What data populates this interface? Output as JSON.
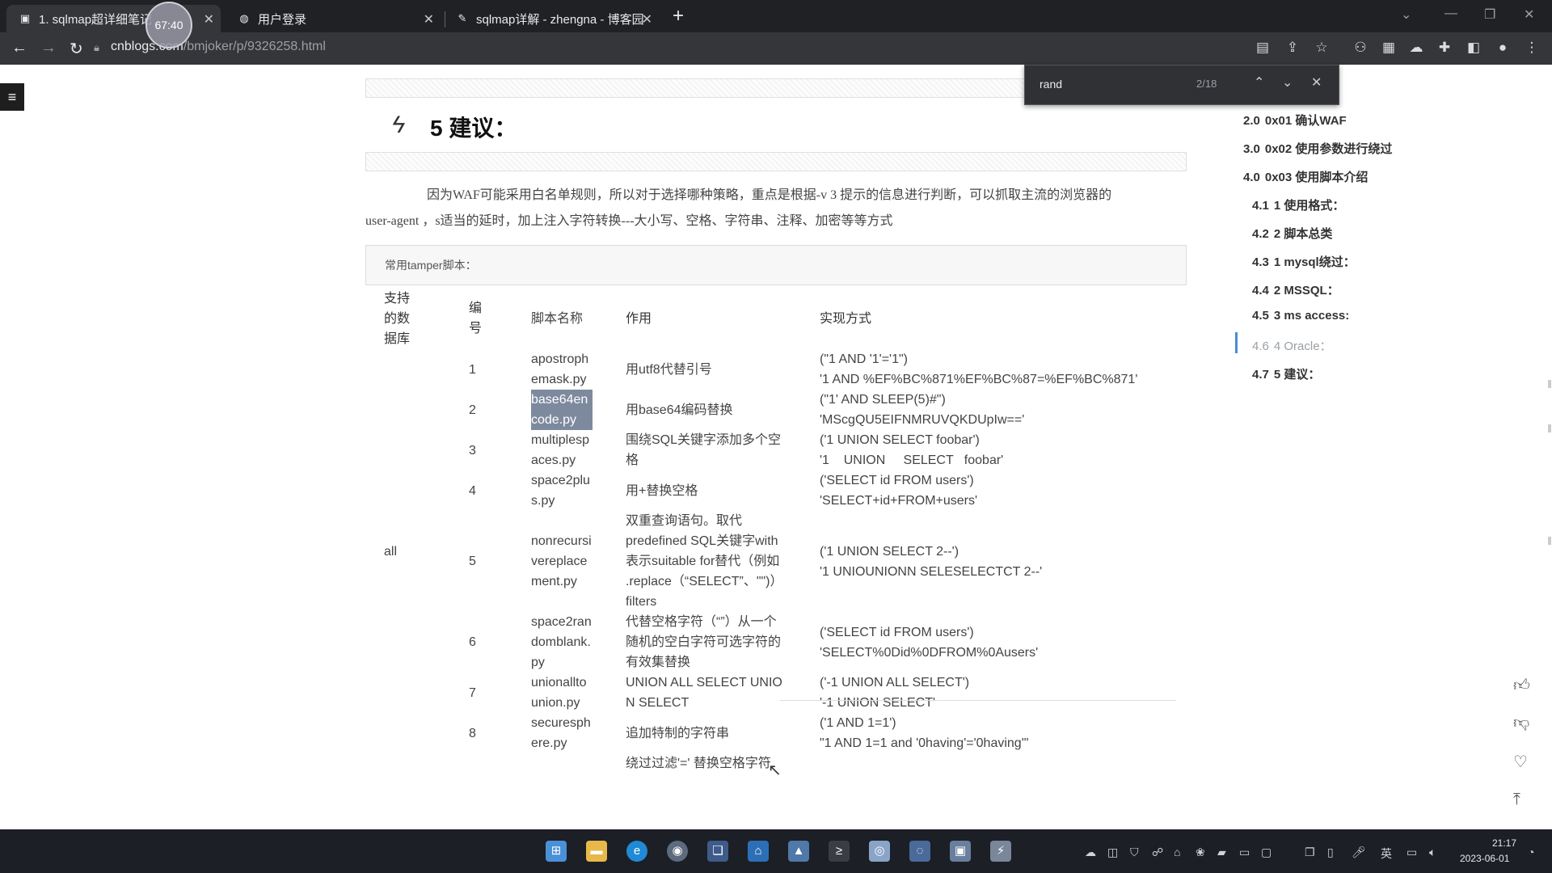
{
  "browser": {
    "tabs": [
      {
        "title": "1. sqlmap超详细笔记",
        "favicon": "blog-icon"
      },
      {
        "title": "用户登录",
        "favicon": "globe-icon"
      },
      {
        "title": "sqlmap详解 - zhengna - 博客园",
        "favicon": "feather-icon"
      }
    ],
    "timer": "67:40",
    "url_host": "cnblogs.com",
    "url_path": "/bmjoker/p/9326258.html"
  },
  "find": {
    "query": "rand",
    "count": "2/18"
  },
  "article": {
    "heading_number": "5",
    "heading_text": "建议：",
    "paragraph_line1": "因为WAF可能采用白名单规则，所以对于选择哪种策略，重点是根据-v 3 提示的信息进行判断，可以抓取主流的浏览器的",
    "paragraph_line2": "user-agent ，s适当的延时，加上注入字符转换---大小写、空格、字符串、注释、加密等等方式",
    "code_label": "常用tamper脚本：",
    "table": {
      "headers": [
        "支持的数据库",
        "编号",
        "脚本名称",
        "作用",
        "实现方式"
      ],
      "db": "all",
      "rows": [
        {
          "num": "1",
          "script": "apostrophemask.py",
          "effect": "用utf8代替引号",
          "impl1": "(\"1 AND '1'='1\")",
          "impl2": "'1 AND %EF%BC%871%EF%BC%87=%EF%BC%871'"
        },
        {
          "num": "2",
          "script": "base64encode.py",
          "effect": "用base64编码替换",
          "impl1": "(\"1' AND SLEEP(5)#\")",
          "impl2": "'MScgQU5EIFNMRUVQKDUpIw=='"
        },
        {
          "num": "3",
          "script": "multiplespaces.py",
          "effect": "围绕SQL关键字添加多个空格",
          "impl1": "('1 UNION SELECT foobar')",
          "impl2": "'1    UNION     SELECT   foobar'"
        },
        {
          "num": "4",
          "script": "space2plus.py",
          "effect": "用+替换空格",
          "impl1": "('SELECT id FROM users')",
          "impl2": "'SELECT+id+FROM+users'"
        },
        {
          "num": "5",
          "script": "nonrecursivereplacement.py",
          "effect": "双重查询语句。取代predefined SQL关键字with表示suitable for替代（例如 .replace（“SELECT”、\"\")） filters",
          "impl1": "('1 UNION SELECT 2--')",
          "impl2": "'1 UNIOUNIONN SELESELECTCT 2--'"
        },
        {
          "num": "6",
          "script": "space2randomblank.py",
          "effect": "代替空格字符（“”）从一个随机的空白字符可选字符的有效集替换",
          "impl1": "('SELECT id FROM users')",
          "impl2": "'SELECT%0Did%0DFROM%0Ausers'"
        },
        {
          "num": "7",
          "script": "unionalltounion.py",
          "effect": "UNION ALL SELECT UNION SELECT",
          "impl1": "('-1 UNION ALL SELECT')",
          "impl2": "'-1 UNION SELECT'"
        },
        {
          "num": "8",
          "script": "securesphere.py",
          "effect": "追加特制的字符串",
          "impl1": "('1 AND 1=1')",
          "impl2": "\"1 AND 1=1 and '0having'='0having'\""
        }
      ],
      "partial_next": "绕过过滤'=' 替换空格字符"
    }
  },
  "toc": [
    {
      "n": "2.0",
      "t": "0x01 确认WAF"
    },
    {
      "n": "3.0",
      "t": "0x02 使用参数进行绕过"
    },
    {
      "n": "4.0",
      "t": "0x03 使用脚本介绍"
    },
    {
      "n": "4.1",
      "t": "1 使用格式："
    },
    {
      "n": "4.2",
      "t": "2 脚本总类"
    },
    {
      "n": "4.3",
      "t": "1 mysql绕过："
    },
    {
      "n": "4.4",
      "t": "2 MSSQL："
    },
    {
      "n": "4.5",
      "t": "3 ms access:"
    },
    {
      "n": "4.6",
      "t": "4 Oracle："
    },
    {
      "n": "4.7",
      "t": "5 建议："
    }
  ],
  "taskbar": {
    "time": "21:17",
    "date": "2023-06-01",
    "ime": "英"
  }
}
